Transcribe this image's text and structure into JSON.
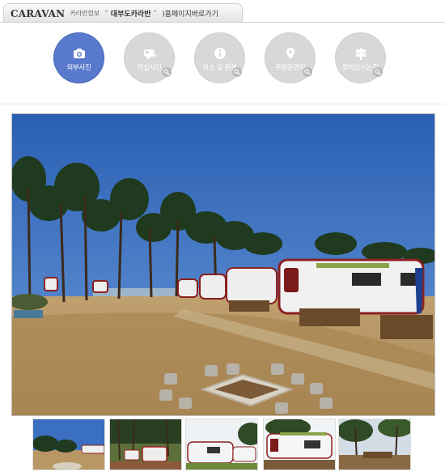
{
  "header": {
    "brand": "CARAVAN",
    "section": "카라반정보",
    "title": "˘ 대부도카라반 ˘",
    "homepage_link": ")홈페이지바로가기"
  },
  "nav": {
    "items": [
      {
        "label": "외부사진",
        "icon": "camera-icon",
        "active": true
      },
      {
        "label": "객실사진",
        "icon": "caravan-icon",
        "active": false
      },
      {
        "label": "취소 및 환불",
        "icon": "info-icon",
        "active": false
      },
      {
        "label": "주변관광지",
        "icon": "map-pin-icon",
        "active": false
      },
      {
        "label": "찾아오시는길",
        "icon": "signpost-icon",
        "active": false
      }
    ]
  },
  "colors": {
    "active": "#5879cc",
    "inactive": "#d7d8da",
    "sky": "#2f67b9"
  },
  "photos": {
    "main": "campsite-caravans-photo",
    "thumbnails": [
      "thumb-campsite",
      "thumb-pine-caravans",
      "thumb-caravan-row",
      "thumb-green-caravan",
      "thumb-trees-deck"
    ]
  }
}
